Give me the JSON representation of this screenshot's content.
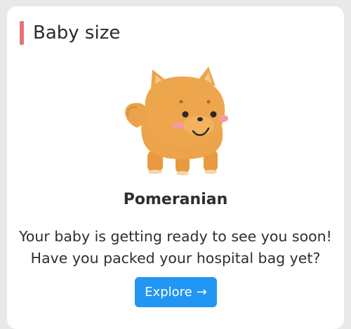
{
  "card": {
    "title": "Baby size",
    "accent_color": "#e8707a",
    "size_name": "Pomeranian",
    "message_line1": "Your baby is getting ready to see you soon!",
    "message_line2": "Have you packed your hospital bag yet?",
    "illustration": "pomeranian-dog-icon",
    "explore_button": {
      "label": "Explore",
      "icon": "arrow-right-icon",
      "icon_glyph": "→",
      "color": "#2196f3"
    }
  }
}
